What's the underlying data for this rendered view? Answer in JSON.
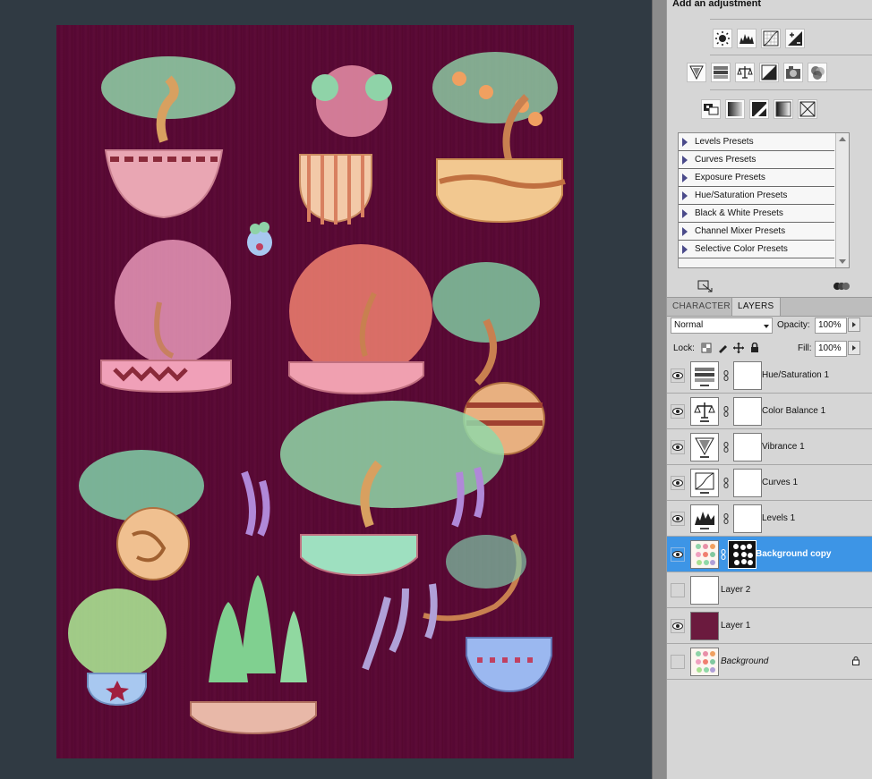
{
  "adjustments": {
    "title": "Add an adjustment",
    "row1": [
      "brightness-contrast-icon",
      "levels-icon",
      "curves-icon",
      "exposure-icon"
    ],
    "row2": [
      "vibrance-icon",
      "hue-saturation-icon",
      "color-balance-icon",
      "black-white-icon",
      "photo-filter-icon",
      "channel-mixer-icon"
    ],
    "row3": [
      "invert-icon",
      "posterize-icon",
      "threshold-icon",
      "gradient-map-icon",
      "selective-color-icon"
    ],
    "presets": [
      "Levels Presets",
      "Curves Presets",
      "Exposure Presets",
      "Hue/Saturation Presets",
      "Black & White Presets",
      "Channel Mixer Presets",
      "Selective Color Presets"
    ]
  },
  "tabs": [
    {
      "label": "CHARACTER",
      "active": false
    },
    {
      "label": "LAYERS",
      "active": true
    }
  ],
  "layer_controls": {
    "blend_mode": "Normal",
    "opacity_label": "Opacity:",
    "opacity_value": "100%",
    "lock_label": "Lock:",
    "fill_label": "Fill:",
    "fill_value": "100%"
  },
  "layers": [
    {
      "name": "Hue/Saturation 1",
      "visible": true,
      "kind": "adjustment",
      "icon": "hue-saturation-icon",
      "selected": false
    },
    {
      "name": "Color Balance 1",
      "visible": true,
      "kind": "adjustment",
      "icon": "color-balance-icon",
      "selected": false
    },
    {
      "name": "Vibrance 1",
      "visible": true,
      "kind": "adjustment",
      "icon": "vibrance-icon",
      "selected": false
    },
    {
      "name": "Curves 1",
      "visible": true,
      "kind": "adjustment",
      "icon": "curves-icon",
      "selected": false
    },
    {
      "name": "Levels 1",
      "visible": true,
      "kind": "adjustment",
      "icon": "levels-icon",
      "selected": false
    },
    {
      "name": "Background copy",
      "visible": true,
      "kind": "image-masked",
      "selected": true
    },
    {
      "name": "Layer 2",
      "visible": false,
      "kind": "white",
      "selected": false
    },
    {
      "name": "Layer 1",
      "visible": true,
      "kind": "fill",
      "selected": false
    },
    {
      "name": "Background",
      "visible": false,
      "kind": "image",
      "locked": true,
      "italic": true,
      "selected": false
    }
  ],
  "colors": {
    "canvas_bg": "#58092f",
    "workspace": "#303a43",
    "panel": "#d6d6d6",
    "selection": "#3d95e6",
    "layer1_fill": "#6b1a3e"
  }
}
